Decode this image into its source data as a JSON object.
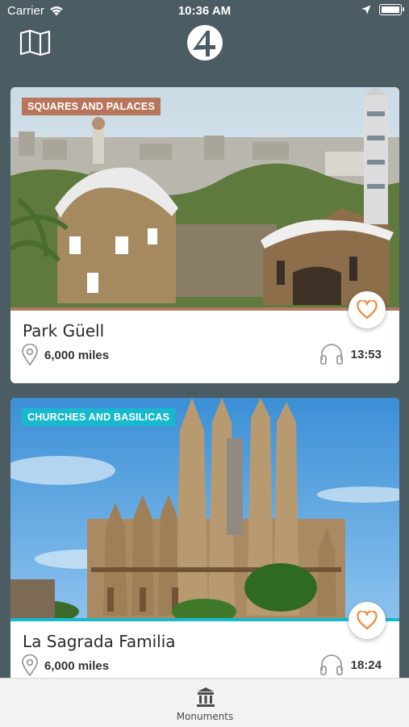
{
  "status_bar": {
    "carrier": "Carrier",
    "time": "10:36 AM"
  },
  "nav": {
    "map_icon": "map-icon",
    "logo_icon": "app-logo"
  },
  "cards": [
    {
      "category": "SQUARES AND PALACES",
      "category_color": "#b7765c",
      "title": "Park Güell",
      "distance": "6,000 miles",
      "duration": "13:53",
      "favorite_icon": "heart-outline-icon"
    },
    {
      "category": "CHURCHES AND BASILICAS",
      "category_color": "#17b9cf",
      "title": "La Sagrada Familia",
      "distance": "6,000 miles",
      "duration": "18:24",
      "favorite_icon": "heart-outline-icon"
    }
  ],
  "tab_bar": {
    "items": [
      {
        "label": "Monuments",
        "icon": "monument-icon"
      }
    ]
  },
  "colors": {
    "background": "#4b5c63",
    "heart": "#f0883a",
    "tab_bar": "#f2f2f2"
  }
}
